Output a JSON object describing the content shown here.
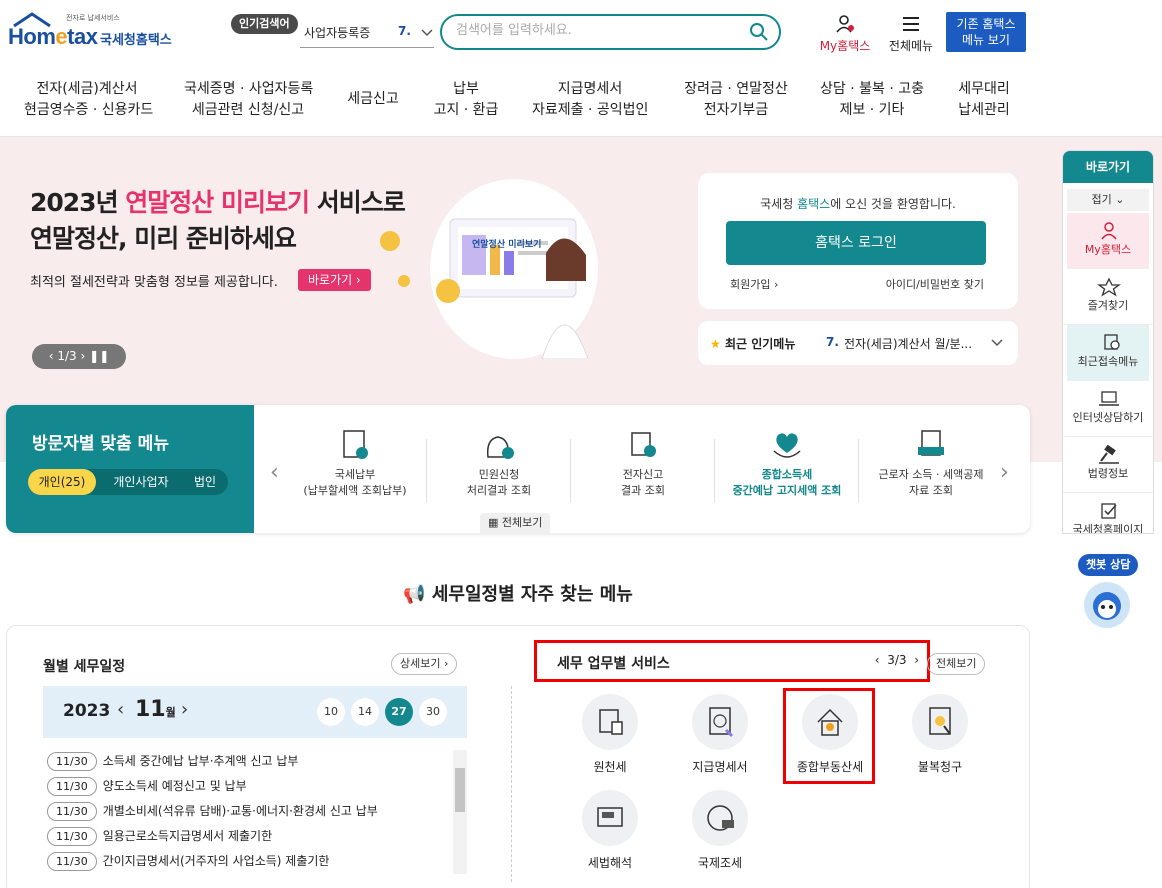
{
  "header": {
    "logo_text": "Hometax",
    "logo_sub": "국세청홈택스",
    "logo_tiny": "전자로 납세서비스",
    "popular_tag": "인기검색어",
    "popular_keyword": "사업자등록증",
    "popular_rank": "7.",
    "search_placeholder": "검색어를 입력하세요.",
    "my_hometax": "My홈택스",
    "all_menu": "전체메뉴",
    "old_menu_line1": "기존 홈택스",
    "old_menu_line2": "메뉴 보기"
  },
  "gnb": [
    {
      "line1": "전자(세금)계산서",
      "line2": "현금영수증 · 신용카드"
    },
    {
      "line1": "국세증명 · 사업자등록",
      "line2": "세금관련 신청/신고"
    },
    {
      "line1": "세금신고",
      "line2": ""
    },
    {
      "line1": "납부",
      "line2": "고지 · 환급"
    },
    {
      "line1": "지급명세서",
      "line2": "자료제출 · 공익법인"
    },
    {
      "line1": "장려금 · 연말정산",
      "line2": "전자기부금"
    },
    {
      "line1": "상담 · 불복 · 고충",
      "line2": "제보 · 기타"
    },
    {
      "line1": "세무대리",
      "line2": "납세관리"
    }
  ],
  "hero": {
    "title_a": "2023년 ",
    "title_pink": "연말정산 미리보기",
    "title_b": " 서비스로",
    "title_line2": "연말정산, 미리 준비하세요",
    "desc": "최적의 절세전략과 맞춤형 정보를 제공합니다.",
    "btn": "바로가기",
    "pager": "1/3",
    "illus_label": "연말정산 미리보기"
  },
  "login": {
    "welcome_a": "국세청 ",
    "welcome_teal": "홈택스",
    "welcome_b": "에 오신 것을 환영합니다.",
    "button": "홈택스 로그인",
    "join": "회원가입",
    "find": "아이디/비밀번호 찾기"
  },
  "popular_menu": {
    "label": "최근 인기메뉴",
    "rank": "7.",
    "value": "전자(세금)계산서 월/분..."
  },
  "quick": {
    "title": "바로가기",
    "fold": "접기",
    "items": [
      "My홈택스",
      "즐겨찾기",
      "최근접속메뉴",
      "인터넷상담하기",
      "법령정보",
      "국세청홈페이지"
    ]
  },
  "chatbot": {
    "label": "챗봇 상담"
  },
  "visitor": {
    "title": "방문자별 맞춤 메뉴",
    "tabs": [
      "개인(25)",
      "개인사업자",
      "법인"
    ],
    "items": [
      {
        "line1": "국세납부",
        "line2": "(납부할세액 조회납부)"
      },
      {
        "line1": "민원신청",
        "line2": "처리결과 조회"
      },
      {
        "line1": "전자신고",
        "line2": "결과 조회"
      },
      {
        "line1": "종합소득세",
        "line2": "중간예납 고지세액 조회"
      },
      {
        "line1": "근로자 소득 · 세액공제",
        "line2": "자료 조회"
      }
    ],
    "view_all": "전체보기"
  },
  "section_title": "세무일정별 자주 찾는 메뉴",
  "schedule": {
    "title": "월별 세무일정",
    "detail": "상세보기",
    "year": "2023",
    "month": "11",
    "month_unit": "월",
    "days": [
      "10",
      "14",
      "27",
      "30"
    ],
    "active_day": "27",
    "rows": [
      {
        "date": "11/30",
        "text": "소득세 중간예납 납부·추계액 신고 납부"
      },
      {
        "date": "11/30",
        "text": "양도소득세 예정신고 및 납부"
      },
      {
        "date": "11/30",
        "text": "개별소비세(석유류 담배)·교통·에너지·환경세 신고 납부"
      },
      {
        "date": "11/30",
        "text": "일용근로소득지급명세서 제출기한"
      },
      {
        "date": "11/30",
        "text": "간이지급명세서(거주자의 사업소득) 제출기한"
      }
    ]
  },
  "business": {
    "title": "세무 업무별 서비스",
    "page": "3/3",
    "view_all": "전체보기",
    "services": [
      "원천세",
      "지급명세서",
      "종합부동산세",
      "불복청구",
      "세법해석",
      "국제조세"
    ]
  }
}
